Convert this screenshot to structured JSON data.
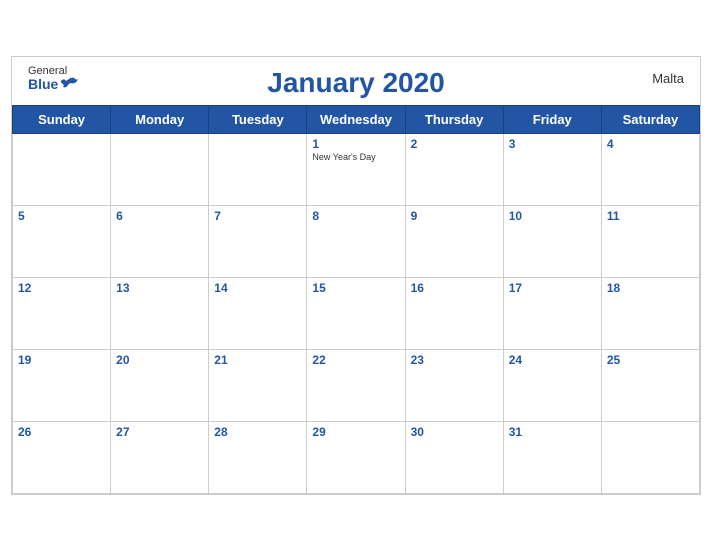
{
  "header": {
    "title": "January 2020",
    "country": "Malta",
    "logo_general": "General",
    "logo_blue": "Blue"
  },
  "weekdays": [
    "Sunday",
    "Monday",
    "Tuesday",
    "Wednesday",
    "Thursday",
    "Friday",
    "Saturday"
  ],
  "weeks": [
    [
      {
        "day": "",
        "empty": true
      },
      {
        "day": "",
        "empty": true
      },
      {
        "day": "",
        "empty": true
      },
      {
        "day": "1",
        "holiday": "New Year's Day"
      },
      {
        "day": "2"
      },
      {
        "day": "3"
      },
      {
        "day": "4"
      }
    ],
    [
      {
        "day": "5"
      },
      {
        "day": "6"
      },
      {
        "day": "7"
      },
      {
        "day": "8"
      },
      {
        "day": "9"
      },
      {
        "day": "10"
      },
      {
        "day": "11"
      }
    ],
    [
      {
        "day": "12"
      },
      {
        "day": "13"
      },
      {
        "day": "14"
      },
      {
        "day": "15"
      },
      {
        "day": "16"
      },
      {
        "day": "17"
      },
      {
        "day": "18"
      }
    ],
    [
      {
        "day": "19"
      },
      {
        "day": "20"
      },
      {
        "day": "21"
      },
      {
        "day": "22"
      },
      {
        "day": "23"
      },
      {
        "day": "24"
      },
      {
        "day": "25"
      }
    ],
    [
      {
        "day": "26"
      },
      {
        "day": "27"
      },
      {
        "day": "28"
      },
      {
        "day": "29"
      },
      {
        "day": "30"
      },
      {
        "day": "31"
      },
      {
        "day": "",
        "empty": true
      }
    ]
  ]
}
